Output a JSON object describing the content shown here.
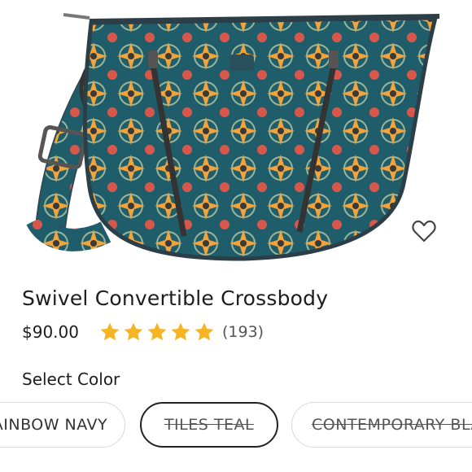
{
  "product": {
    "title": "Swivel Convertible Crossbody",
    "price": "$90.00",
    "rating": 5,
    "review_count": "(193)",
    "image_icon": "product-photo",
    "favorite_icon": "heart-outline-icon"
  },
  "colors": {
    "label": "Select Color",
    "options": [
      {
        "label": "RAINBOW NAVY",
        "selected": false,
        "available": true
      },
      {
        "label": "TILES TEAL",
        "selected": true,
        "available": false
      },
      {
        "label": "CONTEMPORARY BLACK",
        "selected": false,
        "available": false
      }
    ]
  },
  "theme": {
    "star_color": "#f6b323",
    "bag_teal": "#1f5d6b",
    "bag_orange": "#f2a33a"
  }
}
